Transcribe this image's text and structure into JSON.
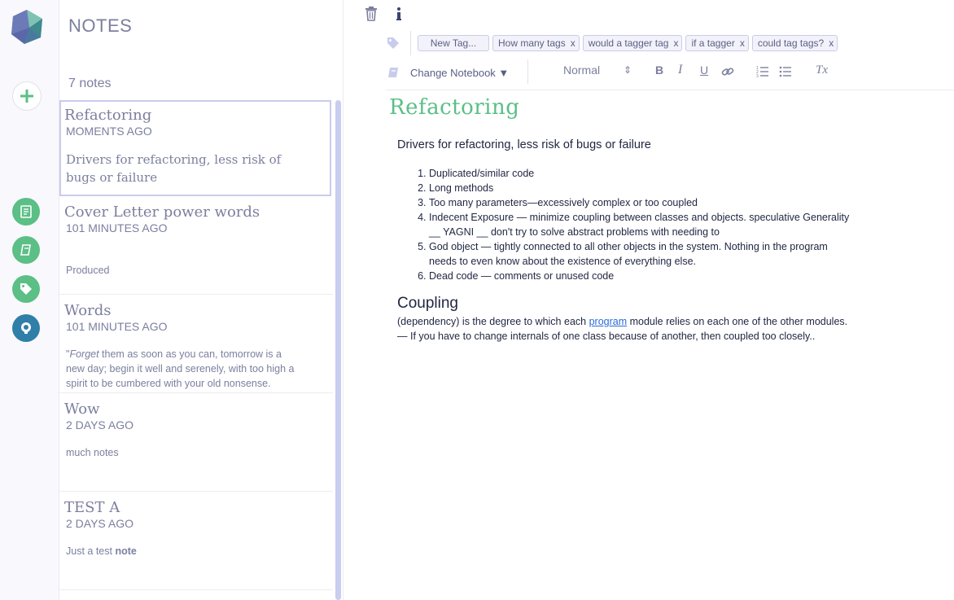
{
  "sidebar": {
    "title": "NOTES",
    "note_count": "7 notes"
  },
  "notes": [
    {
      "title": "Refactoring",
      "time": "MOMENTS AGO",
      "preview": "Drivers for refactoring, less risk of bugs or failure"
    },
    {
      "title": "Cover Letter power words",
      "time": "101 MINUTES AGO",
      "preview": "Produced"
    },
    {
      "title": "Words",
      "time": "101 MINUTES AGO",
      "preview_em": "Forget",
      "preview_pre": "\"",
      "preview_post": " them as soon as you can, tomorrow is a new day; begin it well and serenely, with too high a spirit to be cumbered with your old nonsense."
    },
    {
      "title": "Wow",
      "time": "2 DAYS AGO",
      "preview": "much notes"
    },
    {
      "title": "TEST A",
      "time": "2 DAYS AGO",
      "preview_pre": "Just a test ",
      "preview_bold": "note"
    }
  ],
  "editor": {
    "tags": {
      "new_tag": "New Tag...",
      "items": [
        "How many tags",
        "would a tagger tag",
        "if a tagger",
        "could tag tags?"
      ],
      "remove_glyph": "x"
    },
    "toolbar": {
      "notebook_label": "Change Notebook ▼",
      "format_select": "Normal",
      "format_arrow": "⇕",
      "bold": "B",
      "italic": "I",
      "underline": "U",
      "clear_format": "Tx"
    },
    "doc": {
      "title": "Refactoring",
      "lead": "Drivers for refactoring, less risk of bugs or failure",
      "list": [
        "Duplicated/similar code",
        "Long methods",
        "Too many parameters—excessively complex or too coupled",
        "Indecent Exposure — minimize coupling between classes and objects. speculative Generality __ YAGNI __ don't try to solve abstract problems with needing to",
        "God object — tightly connected to all other objects in the system. Nothing in the program needs to even know about the existence of everything else.",
        "Dead code — comments or unused code"
      ],
      "heading": "Coupling",
      "para_pre": "(dependency) is the degree to which each ",
      "para_link": "program",
      "para_post": " module relies on each one of the other modules.— If you have to change internals of one class because of another, then coupled too closely.."
    }
  },
  "colors": {
    "accent_green": "#5bbf86",
    "github_blue": "#2f7fa8",
    "muted_text": "#7b7f9e",
    "scroll_thumb": "#c9cdef"
  }
}
